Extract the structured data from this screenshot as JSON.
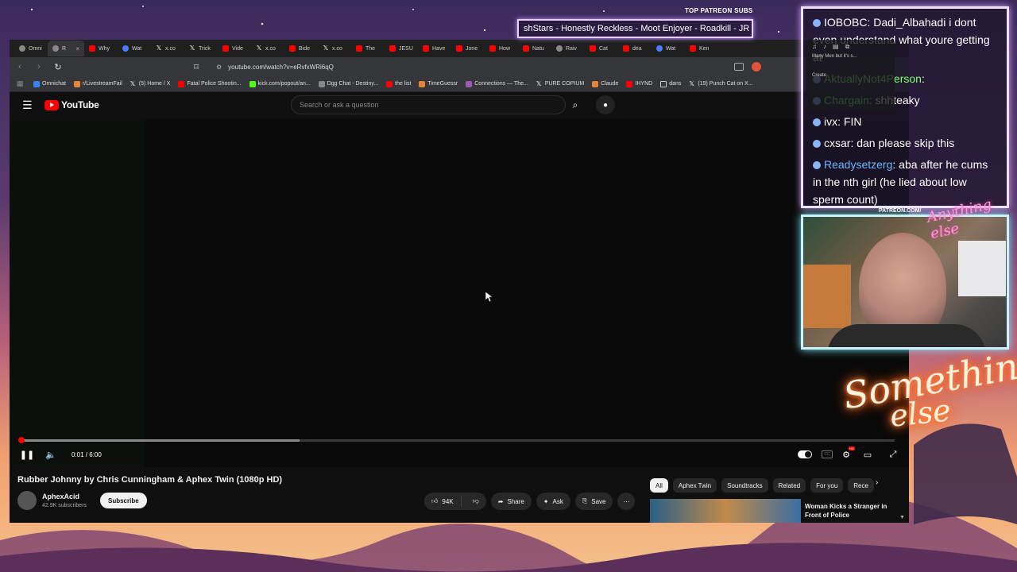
{
  "browser": {
    "tabs": [
      {
        "label": "Omni",
        "icon": "grey"
      },
      {
        "label": "R",
        "icon": "speaker",
        "active": true
      },
      {
        "label": "Why",
        "icon": "yt"
      },
      {
        "label": "Wat",
        "icon": "blue"
      },
      {
        "label": "x.co",
        "icon": "x"
      },
      {
        "label": "Trick",
        "icon": "x"
      },
      {
        "label": "Vide",
        "icon": "yt"
      },
      {
        "label": "x.co",
        "icon": "x"
      },
      {
        "label": "Bide",
        "icon": "yt"
      },
      {
        "label": "x.co",
        "icon": "x"
      },
      {
        "label": "The",
        "icon": "yt"
      },
      {
        "label": "JESU",
        "icon": "yt"
      },
      {
        "label": "Have",
        "icon": "yt"
      },
      {
        "label": "Jone",
        "icon": "yt"
      },
      {
        "label": "How",
        "icon": "yt"
      },
      {
        "label": "Natu",
        "icon": "yt"
      },
      {
        "label": "Raiv",
        "icon": "grey"
      },
      {
        "label": "Cat",
        "icon": "yt"
      },
      {
        "label": "dea",
        "icon": "yt"
      },
      {
        "label": "Wat",
        "icon": "blue"
      },
      {
        "label": "Ken",
        "icon": "yt"
      }
    ],
    "tab_close": "×",
    "url": "youtube.com/watch?v=eRvfxWRi6qQ",
    "bookmarks": [
      {
        "label": "Omnichat",
        "color": "blue"
      },
      {
        "label": "r/LivestreamFail",
        "color": "orange"
      },
      {
        "label": "(5) Home / X",
        "color": "x"
      },
      {
        "label": "Fatal Police Shootin...",
        "color": "red"
      },
      {
        "label": "kick.com/popout/an...",
        "color": "green"
      },
      {
        "label": "Dgg Chat - Destiny...",
        "color": "grey"
      },
      {
        "label": "the list",
        "color": "red"
      },
      {
        "label": "TimeGuessr",
        "color": "orange"
      },
      {
        "label": "Connections — The...",
        "color": "purple"
      },
      {
        "label": "PURE COPIUM",
        "color": "x"
      },
      {
        "label": "Claude",
        "color": "orange"
      },
      {
        "label": "IHYND",
        "color": "red"
      },
      {
        "label": "dans",
        "color": "folder"
      },
      {
        "label": "(19) Punch Cat on X...",
        "color": "x"
      }
    ]
  },
  "youtube": {
    "logo": "YouTube",
    "search_placeholder": "Search or ask a question",
    "player": {
      "time": "0:01 / 6:00",
      "played_fraction": 0.003,
      "buffered_fraction": 0.32,
      "hd_badge": "HD"
    },
    "video_title": "Rubber Johnny by Chris Cunningham & Aphex Twin (1080p HD)",
    "channel": "AphexAcid",
    "subscribers": "42.9K subscribers",
    "subscribe_label": "Subscribe",
    "likes": "94K",
    "share_label": "Share",
    "ask_label": "Ask",
    "save_label": "Save",
    "chips": [
      "All",
      "Aphex Twin",
      "Soundtracks",
      "Related",
      "For you",
      "Rece"
    ],
    "rec_title": "Woman Kicks a Stranger in Front of Police"
  },
  "overlay": {
    "patreon_header": "TOP PATREON SUBS",
    "marquee": "shStars - Honestly Reckless - Moot Enjoyer - Roadkill - JR",
    "chat": [
      {
        "user": "IOBOBC",
        "user_color": "#ffffff",
        "text": ": Dadi_Albahadi i dont even understand what youre getting at"
      },
      {
        "user": "AktuallyNot4Person",
        "user_color": "#7cfc6a",
        "text": ":"
      },
      {
        "user": "Chargain",
        "user_color": "#7cfc6a",
        "text": ": shhteaky"
      },
      {
        "user": "ivx",
        "user_color": "#ffffff",
        "text": ": FIN"
      },
      {
        "user": "cxsar",
        "user_color": "#ffffff",
        "text": ": dan please skip this"
      },
      {
        "user": "Readysetzerg",
        "user_color": "#6ab8ff",
        "text": ": aba after he cums in the nth girl (he lied about low sperm count)"
      }
    ],
    "popup_label": "Create",
    "popup_note": "Many Men but it's s...",
    "patreon_url": "PATREON.COM/",
    "brand_script": "Anything else",
    "neon_line1": "Something",
    "neon_line2": "else"
  }
}
